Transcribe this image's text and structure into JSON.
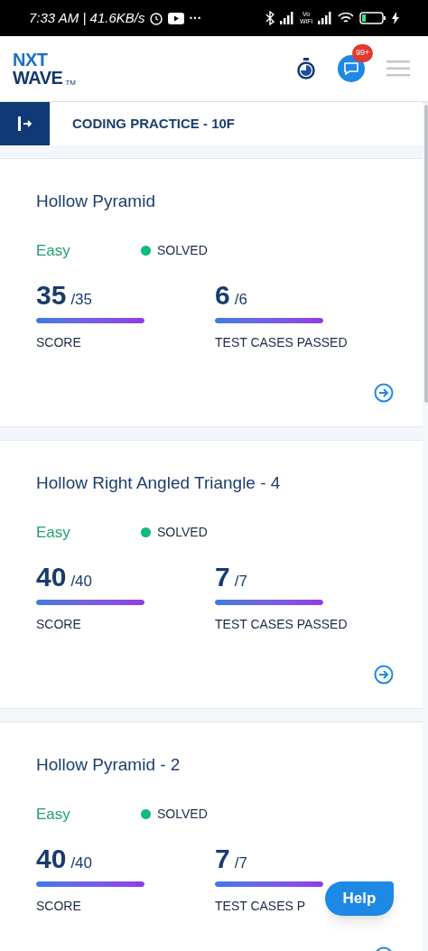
{
  "status_bar": {
    "time": "7:33 AM | 41.6KB/s",
    "more": "···",
    "vowifi": "Vo WiFi"
  },
  "header": {
    "logo_top": "NXT",
    "logo_bottom": "WAVE",
    "trademark": "TM",
    "chat_badge": "99+"
  },
  "section": {
    "title": "CODING PRACTICE - 10F"
  },
  "problems": [
    {
      "title": "Hollow Pyramid",
      "difficulty": "Easy",
      "status": {
        "text": "SOLVED",
        "color": "#10b981"
      },
      "metrics": [
        {
          "value": "35",
          "total": "/35",
          "label": "SCORE",
          "level": 1
        },
        {
          "value": "6",
          "total": "/6",
          "label": "TEST CASES PASSED",
          "level": 1
        }
      ]
    },
    {
      "title": "Hollow Right Angled Triangle - 4",
      "difficulty": "Easy",
      "status": {
        "text": "SOLVED",
        "color": "#10b981"
      },
      "metrics": [
        {
          "value": "40",
          "total": "/40",
          "label": "SCORE",
          "level": 1
        },
        {
          "value": "7",
          "total": "/7",
          "label": "TEST CASES PASSED",
          "level": 1
        }
      ]
    },
    {
      "title": "Hollow Pyramid - 2",
      "difficulty": "Easy",
      "status": {
        "text": "SOLVED",
        "color": "#10b981"
      },
      "metrics": [
        {
          "value": "40",
          "total": "/40",
          "label": "SCORE",
          "level": 1
        },
        {
          "value": "7",
          "total": "/7",
          "label": "TEST CASES P",
          "level": 1
        }
      ]
    }
  ],
  "help_button": "Help"
}
